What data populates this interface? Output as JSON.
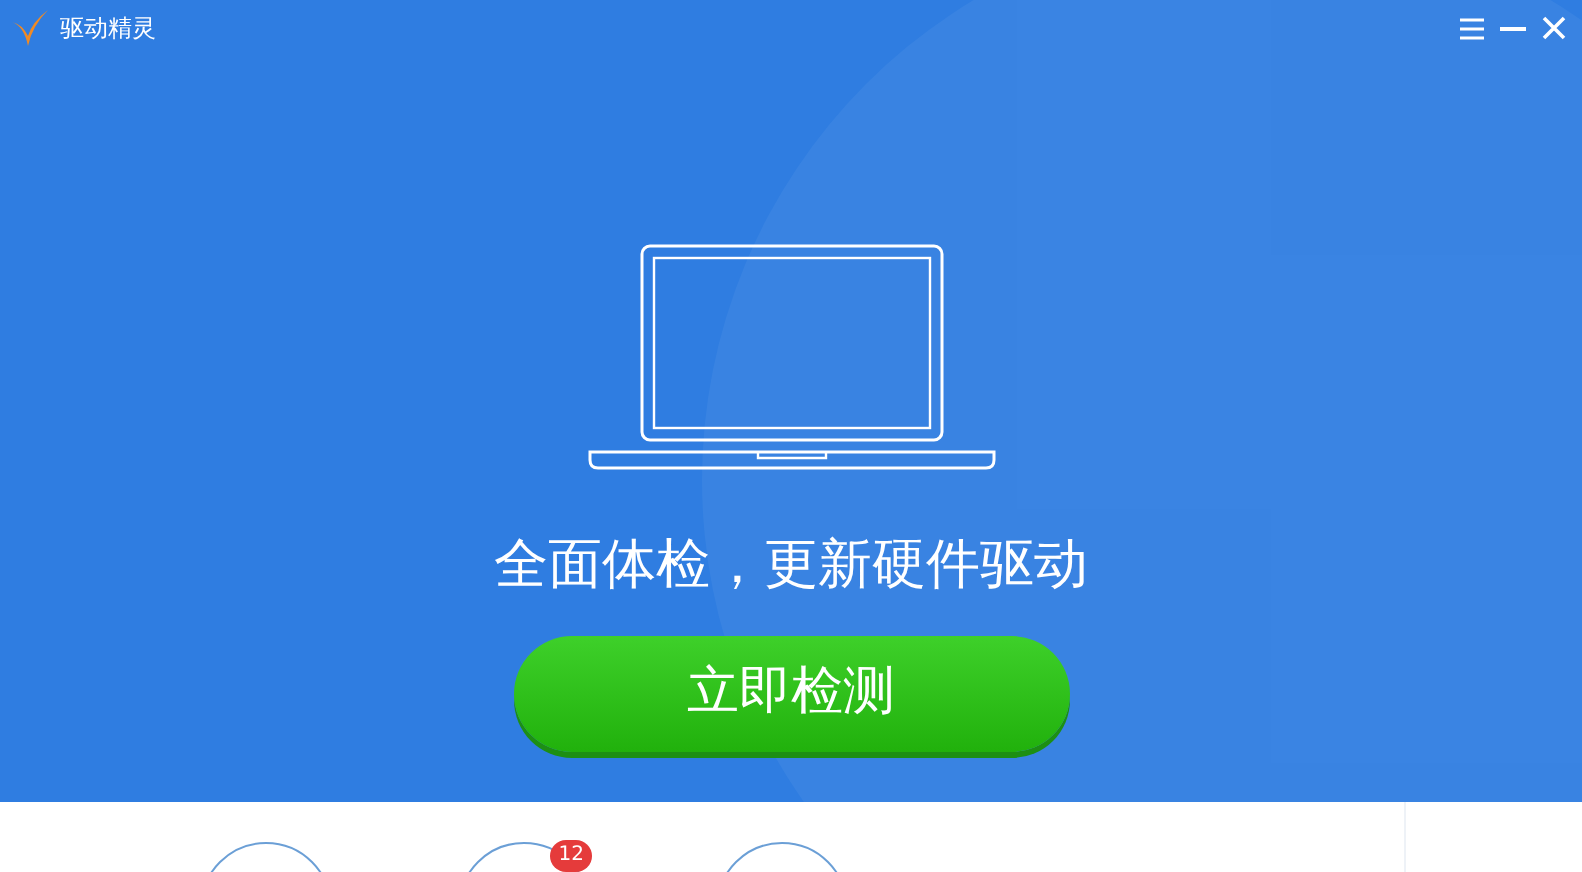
{
  "window": {
    "title": "驱动精灵"
  },
  "hero": {
    "tagline": "全面体检，更新硬件驱动",
    "scan_button": "立即检测"
  },
  "features": [
    {
      "kind": "plain"
    },
    {
      "kind": "badged",
      "badge": "12"
    },
    {
      "kind": "plain"
    }
  ]
}
